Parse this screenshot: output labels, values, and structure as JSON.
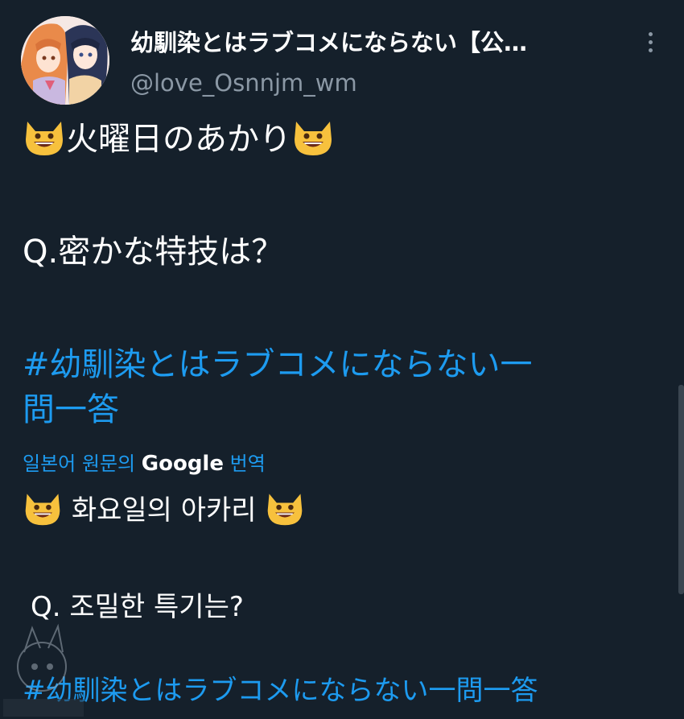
{
  "user": {
    "display_name": "幼馴染とはラブコメにならない【公…",
    "handle": "@love_Osnnjm_wm"
  },
  "tweet": {
    "line1": "火曜日のあかり",
    "question": "Q.密かな特技は？",
    "hashtag_line1": "#幼馴染とはラブコメにならない一",
    "hashtag_line2": "問一答"
  },
  "translation": {
    "label_prefix": "일본어 원문의",
    "label_google": "Google",
    "label_suffix": "번역",
    "line1": "화요일의 아카리",
    "question": "Q. 조밀한 특기는?",
    "hashtag": "#幼馴染とはラブコメにならない一問一答"
  },
  "icons": {
    "avatar": "anime-avatar",
    "more": "more-vertical-icon",
    "emoji": "grinning-cat-emoji"
  },
  "colors": {
    "background": "#15202b",
    "link": "#1d9bf0",
    "muted": "#8b98a5"
  }
}
